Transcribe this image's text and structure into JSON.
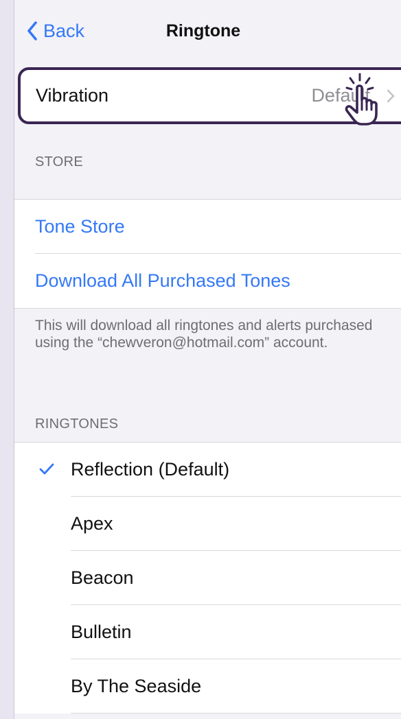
{
  "nav": {
    "back_label": "Back",
    "title": "Ringtone"
  },
  "vibration": {
    "label": "Vibration",
    "value": "Default"
  },
  "store": {
    "header": "STORE",
    "items": [
      {
        "label": "Tone Store"
      },
      {
        "label": "Download All Purchased Tones"
      }
    ],
    "footer": "This will download all ringtones and alerts purchased using the “chewveron@hotmail.com” account."
  },
  "ringtones": {
    "header": "RINGTONES",
    "selected": "Reflection (Default)",
    "items": [
      {
        "label": "Reflection (Default)"
      },
      {
        "label": "Apex"
      },
      {
        "label": "Beacon"
      },
      {
        "label": "Bulletin"
      },
      {
        "label": "By The Seaside"
      }
    ]
  },
  "colors": {
    "accent": "#3478f6",
    "highlight_border": "#3a2652",
    "background": "#f2f2f7",
    "outer_background": "#e8e4f0"
  },
  "icons": {
    "back": "chevron-left-icon",
    "disclosure": "chevron-right-icon",
    "selected": "checkmark-icon",
    "pointer": "hand-pointer-icon"
  }
}
